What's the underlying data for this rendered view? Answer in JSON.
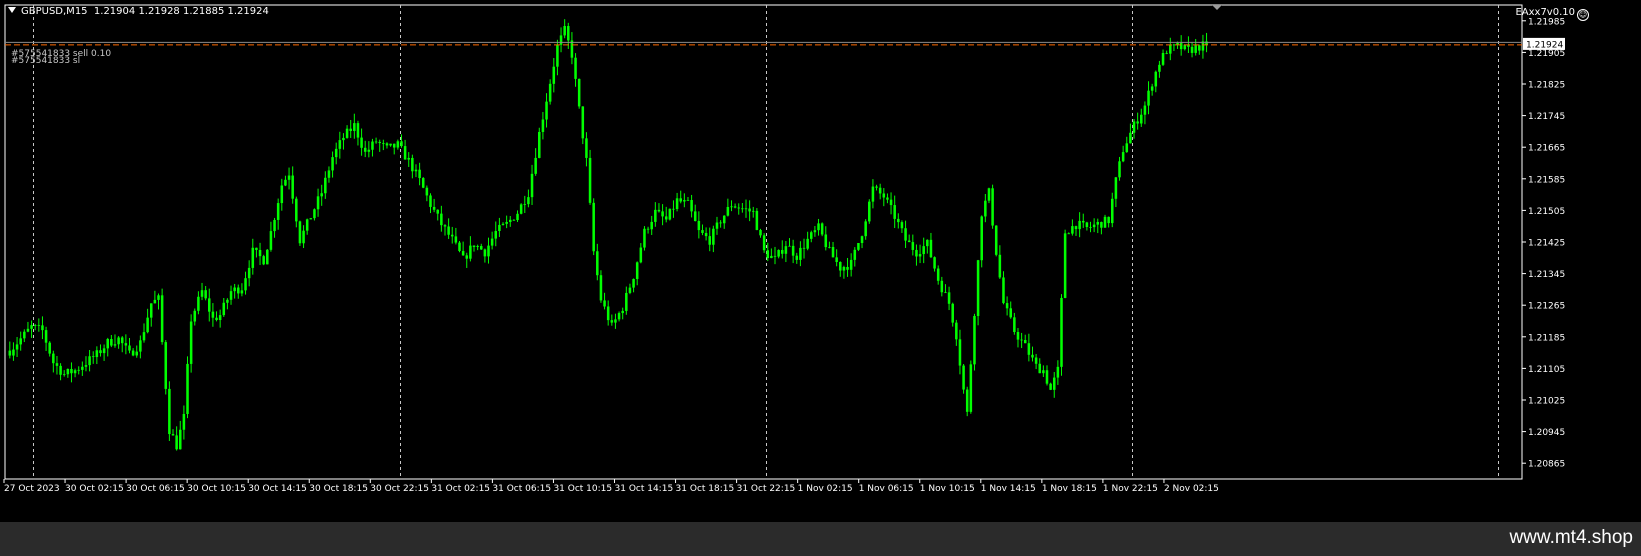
{
  "header": {
    "symbol_tf": "GBPUSD,M15",
    "ohlc": "1.21904 1.21928 1.21885 1.21924"
  },
  "ea_label": "EAxx7v0.10",
  "order_labels": {
    "line1": "#575541833 sell 0.10",
    "line2": "#575541833 sl"
  },
  "current_price": "1.21924",
  "watermark": "www.mt4.shop",
  "colors": {
    "background": "#000000",
    "candle": "#00ff00",
    "grid": "#c8c8c8",
    "order_line": "#ff6a00",
    "axis_text": "#ffffff",
    "footer": "#2b2b2b"
  },
  "chart_data": {
    "type": "candlestick",
    "symbol": "GBPUSD",
    "timeframe": "M15",
    "ylim": [
      1.20825,
      1.22025
    ],
    "y_ticks": [
      "1.21985",
      "1.21905",
      "1.21825",
      "1.21745",
      "1.21665",
      "1.21585",
      "1.21505",
      "1.21425",
      "1.21345",
      "1.21265",
      "1.21185",
      "1.21105",
      "1.21025",
      "1.20945",
      "1.20865"
    ],
    "x_ticks": [
      "27 Oct 2023",
      "30 Oct 02:15",
      "30 Oct 06:15",
      "30 Oct 10:15",
      "30 Oct 14:15",
      "30 Oct 18:15",
      "30 Oct 22:15",
      "31 Oct 02:15",
      "31 Oct 06:15",
      "31 Oct 10:15",
      "31 Oct 14:15",
      "31 Oct 18:15",
      "31 Oct 22:15",
      "1 Nov 02:15",
      "1 Nov 06:15",
      "1 Nov 10:15",
      "1 Nov 14:15",
      "1 Nov 18:15",
      "1 Nov 22:15",
      "2 Nov 02:15"
    ],
    "grid": "vertical day separators",
    "current_price": 1.21924,
    "order_price": 1.21924,
    "price_path": [
      [
        0,
        1.2115
      ],
      [
        3,
        1.2118
      ],
      [
        6,
        1.2121
      ],
      [
        9,
        1.212
      ],
      [
        12,
        1.2112
      ],
      [
        15,
        1.2109
      ],
      [
        18,
        1.211
      ],
      [
        21,
        1.2112
      ],
      [
        24,
        1.2114
      ],
      [
        27,
        1.2117
      ],
      [
        30,
        1.2118
      ],
      [
        33,
        1.2114
      ],
      [
        36,
        1.2117
      ],
      [
        39,
        1.2127
      ],
      [
        41,
        1.2128
      ],
      [
        44,
        1.2095
      ],
      [
        46,
        1.2091
      ],
      [
        48,
        1.2098
      ],
      [
        50,
        1.2123
      ],
      [
        53,
        1.213
      ],
      [
        56,
        1.2123
      ],
      [
        58,
        1.2124
      ],
      [
        61,
        1.213
      ],
      [
        64,
        1.2131
      ],
      [
        67,
        1.214
      ],
      [
        70,
        1.2138
      ],
      [
        72,
        1.2145
      ],
      [
        75,
        1.2157
      ],
      [
        77,
        1.216
      ],
      [
        80,
        1.2143
      ],
      [
        83,
        1.2149
      ],
      [
        86,
        1.2155
      ],
      [
        89,
        1.2164
      ],
      [
        92,
        1.2169
      ],
      [
        95,
        1.2172
      ],
      [
        98,
        1.2165
      ],
      [
        101,
        1.2168
      ],
      [
        104,
        1.2166
      ],
      [
        107,
        1.2167
      ],
      [
        110,
        1.2163
      ],
      [
        113,
        1.2158
      ],
      [
        116,
        1.2152
      ],
      [
        119,
        1.2147
      ],
      [
        122,
        1.2143
      ],
      [
        125,
        1.2138
      ],
      [
        128,
        1.2142
      ],
      [
        131,
        1.214
      ],
      [
        134,
        1.2145
      ],
      [
        137,
        1.2147
      ],
      [
        140,
        1.215
      ],
      [
        143,
        1.2155
      ],
      [
        146,
        1.217
      ],
      [
        149,
        1.2183
      ],
      [
        151,
        1.2192
      ],
      [
        153,
        1.2196
      ],
      [
        155,
        1.219
      ],
      [
        157,
        1.2176
      ],
      [
        159,
        1.2163
      ],
      [
        161,
        1.214
      ],
      [
        163,
        1.2128
      ],
      [
        166,
        1.2121
      ],
      [
        169,
        1.2126
      ],
      [
        172,
        1.2134
      ],
      [
        175,
        1.2145
      ],
      [
        178,
        1.215
      ],
      [
        181,
        1.2148
      ],
      [
        184,
        1.2153
      ],
      [
        187,
        1.2152
      ],
      [
        190,
        1.2145
      ],
      [
        193,
        1.2143
      ],
      [
        196,
        1.2148
      ],
      [
        199,
        1.2152
      ],
      [
        202,
        1.2151
      ],
      [
        205,
        1.215
      ],
      [
        208,
        1.214
      ],
      [
        211,
        1.2138
      ],
      [
        214,
        1.2142
      ],
      [
        217,
        1.2139
      ],
      [
        220,
        1.2143
      ],
      [
        223,
        1.2146
      ],
      [
        226,
        1.214
      ],
      [
        229,
        1.2136
      ],
      [
        232,
        1.2137
      ],
      [
        235,
        1.2145
      ],
      [
        238,
        1.2156
      ],
      [
        241,
        1.2154
      ],
      [
        244,
        1.2149
      ],
      [
        247,
        1.2143
      ],
      [
        250,
        1.214
      ],
      [
        253,
        1.2142
      ],
      [
        256,
        1.2133
      ],
      [
        259,
        1.2127
      ],
      [
        261,
        1.2119
      ],
      [
        263,
        1.2105
      ],
      [
        264,
        1.2099
      ],
      [
        266,
        1.2125
      ],
      [
        268,
        1.215
      ],
      [
        270,
        1.2155
      ],
      [
        272,
        1.214
      ],
      [
        274,
        1.2127
      ],
      [
        277,
        1.212
      ],
      [
        280,
        1.2116
      ],
      [
        283,
        1.2111
      ],
      [
        285,
        1.211
      ],
      [
        287,
        1.2105
      ],
      [
        289,
        1.211
      ],
      [
        291,
        1.2145
      ],
      [
        294,
        1.2147
      ],
      [
        297,
        1.2146
      ],
      [
        300,
        1.2147
      ],
      [
        303,
        1.2148
      ],
      [
        305,
        1.2158
      ],
      [
        307,
        1.2166
      ],
      [
        310,
        1.2172
      ],
      [
        313,
        1.2177
      ],
      [
        315,
        1.2183
      ],
      [
        317,
        1.2188
      ],
      [
        319,
        1.2191
      ],
      [
        322,
        1.2192
      ],
      [
        325,
        1.2191
      ],
      [
        328,
        1.2192
      ],
      [
        330,
        1.21924
      ]
    ]
  }
}
